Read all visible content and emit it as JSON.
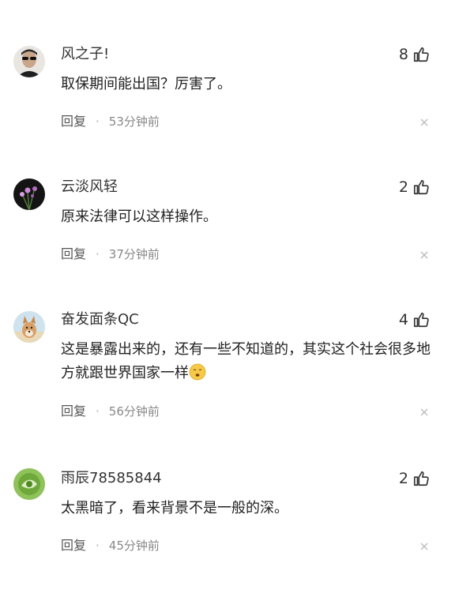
{
  "comments": [
    {
      "username": "风之子!",
      "likes": "8",
      "content": "取保期间能出国？厉害了。",
      "reply": "回复",
      "dot": "·",
      "time": "53分钟前",
      "avatar": "avatar-man-sunglasses"
    },
    {
      "username": "云淡风轻",
      "likes": "2",
      "content": "原来法律可以这样操作。",
      "reply": "回复",
      "dot": "·",
      "time": "37分钟前",
      "avatar": "avatar-flowers"
    },
    {
      "username": "奋发面条QC",
      "likes": "4",
      "content": "这是暴露出来的，还有一些不知道的，其实这个社会很多地方就跟世界国家一样",
      "emoji": "smirk-emoji",
      "reply": "回复",
      "dot": "·",
      "time": "56分钟前",
      "avatar": "avatar-dog"
    },
    {
      "username": "雨辰78585844",
      "likes": "2",
      "content": "太黑暗了，看来背景不是一般的深。",
      "reply": "回复",
      "dot": "·",
      "time": "45分钟前",
      "avatar": "avatar-green-circle"
    }
  ],
  "icons": {
    "like": "thumb-up-icon",
    "close": "close-icon"
  },
  "colors": {
    "text": "#222222",
    "meta": "#888888",
    "background": "#ffffff"
  }
}
